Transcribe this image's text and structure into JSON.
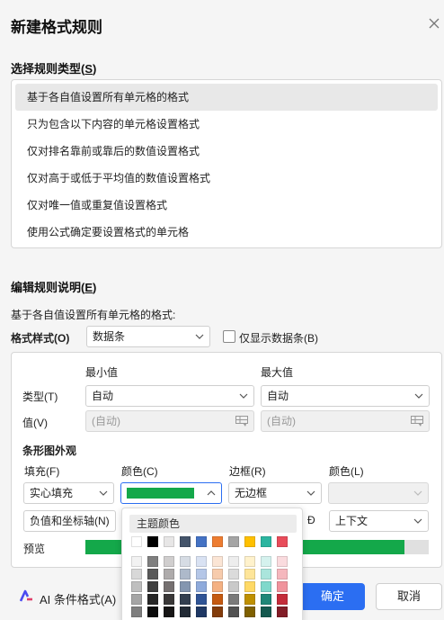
{
  "dialog": {
    "title": "新建格式规则"
  },
  "rule_type": {
    "heading": "选择规则类型(S)",
    "heading_text": "选择规则类型(",
    "heading_key": "S",
    "heading_end": ")",
    "items": [
      "基于各自值设置所有单元格的格式",
      "只为包含以下内容的单元格设置格式",
      "仅对排名靠前或靠后的数值设置格式",
      "仅对高于或低于平均值的数值设置格式",
      "仅对唯一值或重复值设置格式",
      "使用公式确定要设置格式的单元格"
    ],
    "selected_index": 0
  },
  "edit": {
    "heading_text": "编辑规则说明(",
    "heading_key": "E",
    "heading_end": ")",
    "desc": "基于各自值设置所有单元格的格式:",
    "format_style_label": "格式样式(O)",
    "format_style_value": "数据条",
    "show_bar_only_label": "仅显示数据条(B)",
    "show_bar_only_checked": false
  },
  "panel": {
    "min_header": "最小值",
    "max_header": "最大值",
    "type_label": "类型(T)",
    "min_type": "自动",
    "max_type": "自动",
    "value_label": "值(V)",
    "min_value_placeholder": "(自动)",
    "max_value_placeholder": "(自动)",
    "bar_appearance": "条形图外观",
    "fill_label": "填充(F)",
    "color_label": "颜色(C)",
    "border_label": "边框(R)",
    "border_color_label": "颜色(L)",
    "fill_value": "实心填充",
    "border_value": "无边框",
    "fill_color": "#14a84a",
    "axis_button": "负值和坐标轴(N)",
    "direction_label_tail": "向(D)",
    "direction_label_visible": "Ð",
    "direction_value": "上下文",
    "preview_label": "预览",
    "preview_fill_fraction": 0.93
  },
  "color_popup": {
    "heading": "主题颜色",
    "theme_row": [
      "#ffffff",
      "#000000",
      "#e7e6e6",
      "#44546a",
      "#4472c4",
      "#ed7d31",
      "#a5a5a5",
      "#ffc000",
      "#2bb5a0",
      "#e84c5a"
    ],
    "shade_rows": [
      [
        "#f2f2f2",
        "#7f7f7f",
        "#d0cece",
        "#d6dce4",
        "#d9e2f3",
        "#fbe5d5",
        "#ededed",
        "#fff2cc",
        "#d5f2ee",
        "#fadbde"
      ],
      [
        "#d8d8d8",
        "#595959",
        "#aeabab",
        "#adb9ca",
        "#b4c6e7",
        "#f7cbac",
        "#dbdbdb",
        "#fee599",
        "#aae5dc",
        "#f5b7bd"
      ],
      [
        "#bfbfbf",
        "#3f3f3f",
        "#757070",
        "#8496b0",
        "#8eaadb",
        "#f4b183",
        "#c9c9c9",
        "#ffd965",
        "#80d8cb",
        "#f0939c"
      ],
      [
        "#a5a5a5",
        "#262626",
        "#3a3838",
        "#323e4f",
        "#2f5496",
        "#c55a11",
        "#7b7b7b",
        "#bf9000",
        "#1f8778",
        "#c42c3a"
      ],
      [
        "#7f7f7f",
        "#0c0c0c",
        "#171616",
        "#222a35",
        "#1f3864",
        "#833c0b",
        "#525252",
        "#7f6000",
        "#14594f",
        "#821d27"
      ]
    ]
  },
  "footer": {
    "ai_label": "AI 条件格式(A)",
    "ok": "确定",
    "cancel": "取消",
    "accent": "#2b6ef2"
  }
}
